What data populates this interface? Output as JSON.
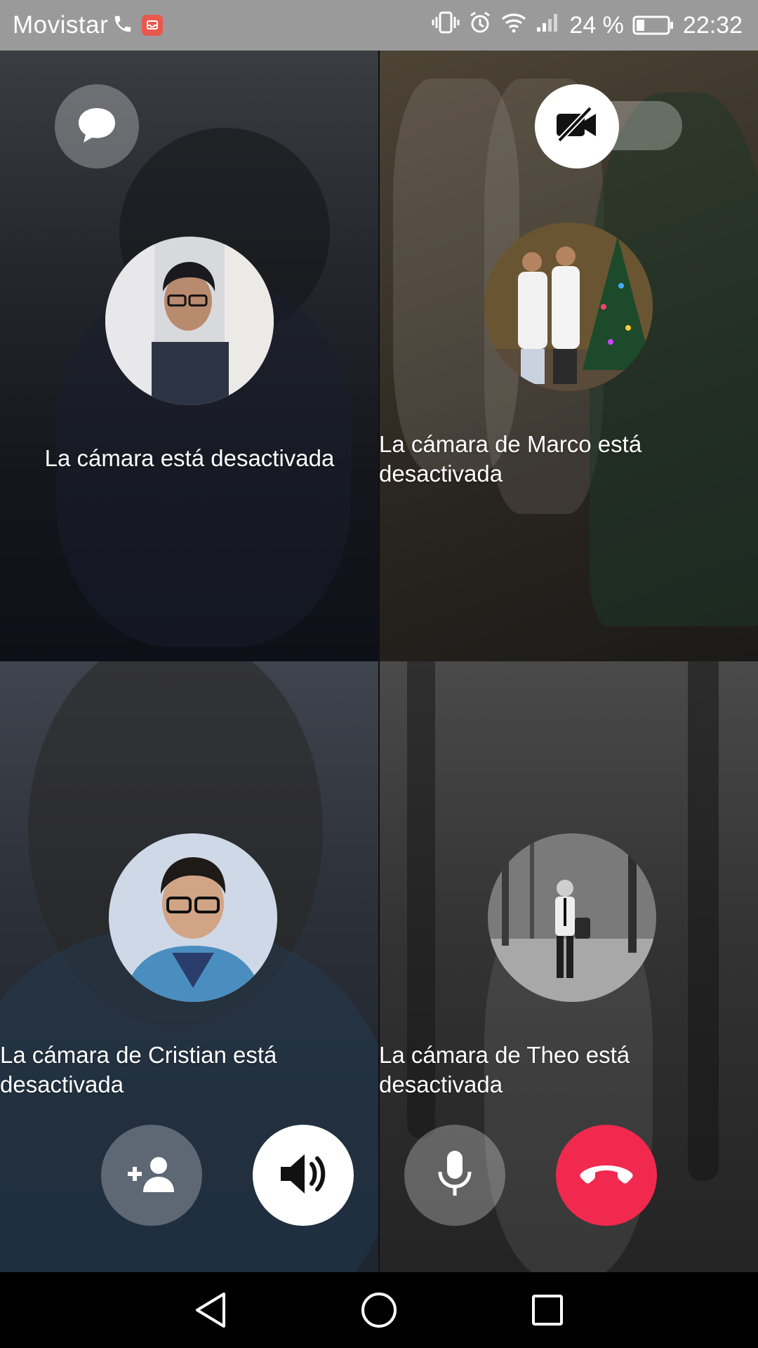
{
  "status_bar": {
    "carrier": "Movistar",
    "battery_percent": "24 %",
    "time": "22:32",
    "icons": [
      "phone-call-icon",
      "app-notification-icon",
      "vibrate-icon",
      "alarm-icon",
      "wifi-icon",
      "signal-icon",
      "battery-icon"
    ]
  },
  "participants": [
    {
      "camera_off_text": "La cámara está desactivada"
    },
    {
      "camera_off_text": "La cámara de Marco está desactivada"
    },
    {
      "camera_off_text": "La cámara de Cristian está desactivada"
    },
    {
      "camera_off_text": "La cámara de Theo está desactivada"
    }
  ],
  "top_controls": {
    "chat_icon": "chat-bubble-icon",
    "camera_icon": "video-off-icon"
  },
  "bottom_controls": [
    {
      "name": "add-participant",
      "icon": "add-person-icon"
    },
    {
      "name": "speaker",
      "icon": "speaker-icon"
    },
    {
      "name": "microphone",
      "icon": "microphone-icon"
    },
    {
      "name": "end-call",
      "icon": "hang-up-icon"
    }
  ],
  "colors": {
    "status_bar": "#9a9a9a",
    "end_call": "#f2294f",
    "control_light": "#ffffff"
  },
  "nav_bar": {
    "icons": [
      "back-icon",
      "home-icon",
      "recent-apps-icon"
    ]
  }
}
